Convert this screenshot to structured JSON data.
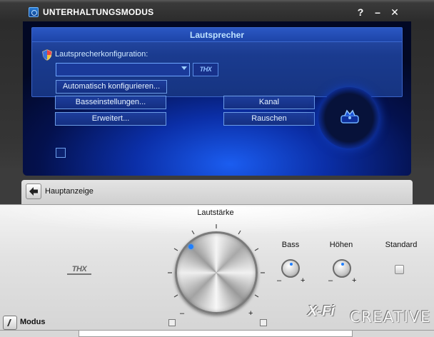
{
  "window": {
    "title": "UNTERHALTUNGSMODUS",
    "help": "?",
    "minimize": "–",
    "close": "✕"
  },
  "speaker_section": {
    "title": "Lautsprecher",
    "config_label": "Lautsprecherkonfiguration:",
    "config_value": "",
    "thx_badge": "THX",
    "auto_configure": "Automatisch konfigurieren...",
    "bass_settings": "Basseinstellungen...",
    "advanced": "Erweitert...",
    "channel": "Kanal",
    "noise": "Rauschen"
  },
  "nav": {
    "main_view": "Hauptanzeige"
  },
  "controls": {
    "volume_label": "Lautstärke",
    "bass_label": "Bass",
    "treble_label": "Höhen",
    "standard_label": "Standard",
    "minus": "–",
    "plus": "+",
    "thx_logo": "THX",
    "xfi_logo": "X-Fi",
    "brand": "CREATIVE",
    "mode_label": "Modus"
  },
  "colors": {
    "panel_blue": "#0b2fa8",
    "accent": "#1f7fff"
  }
}
